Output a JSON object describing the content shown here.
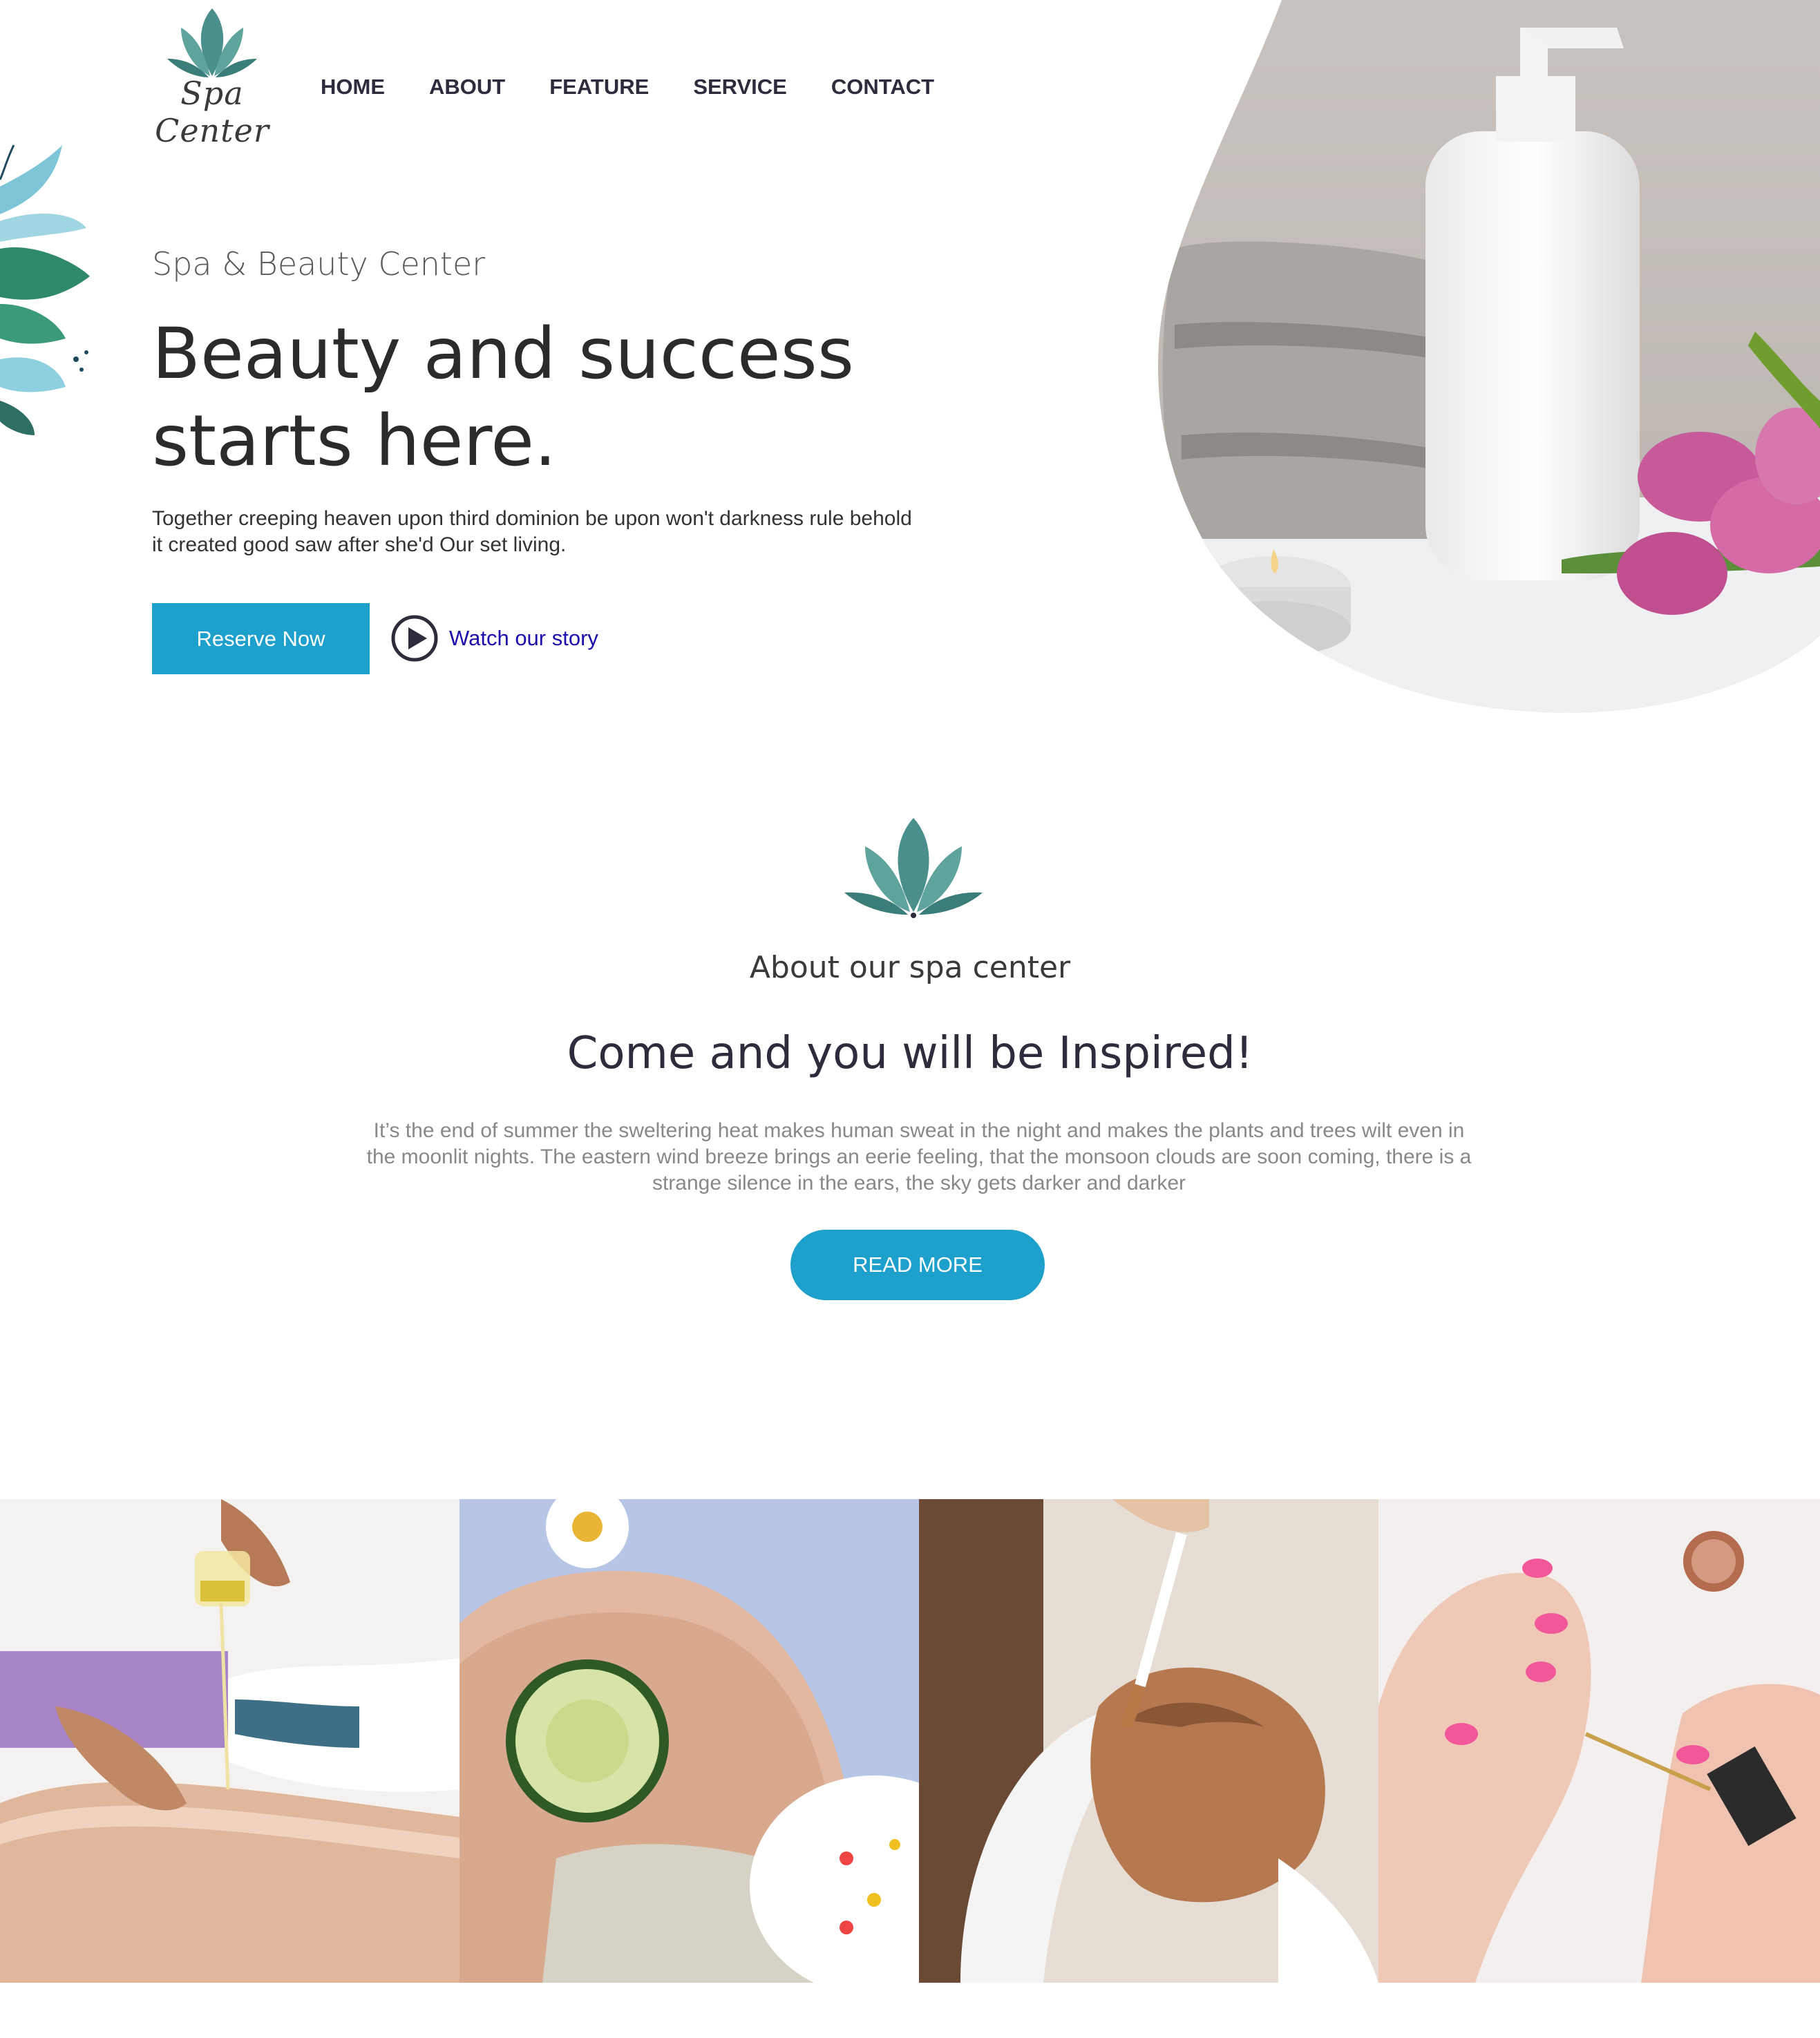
{
  "header": {
    "logo_text": "Spa Center",
    "nav": [
      "HOME",
      "ABOUT",
      "FEATURE",
      "SERVICE",
      "CONTACT"
    ]
  },
  "hero": {
    "subtitle": "Spa & Beauty Center",
    "title_line1": "Beauty and success",
    "title_line2": "starts here.",
    "description": "Together creeping heaven upon third dominion be upon won't darkness rule behold it created good saw after she'd Our set living.",
    "reserve_label": "Reserve Now",
    "watch_label": "Watch our story"
  },
  "about": {
    "subtitle": "About our spa center",
    "title": "Come and you will be Inspired!",
    "text": "It’s the end of summer the sweltering heat makes human sweat in the night and makes the plants and trees wilt even in the moonlit nights. The eastern wind breeze brings an eerie feeling, that the monsoon clouds are soon coming, there is a strange silence in the ears, the sky gets darker and darker",
    "read_more_label": "READ MORE"
  },
  "colors": {
    "accent": "#1da0cc",
    "heading": "#2f2b3d",
    "lotus": "#3f8b85",
    "link": "#1a0dab"
  }
}
